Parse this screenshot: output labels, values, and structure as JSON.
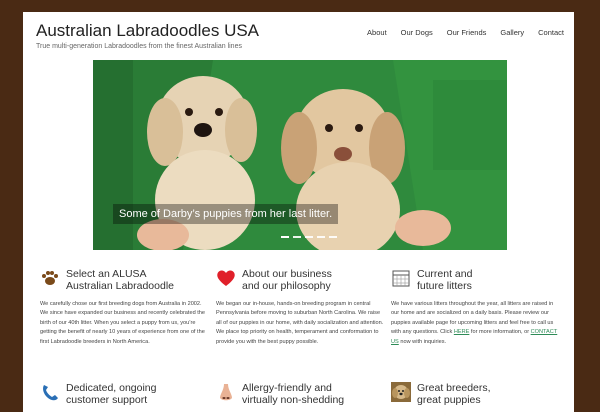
{
  "site": {
    "title": "Australian Labradoodles USA",
    "tagline": "True multi-generation Labradoodles from the finest Australian lines"
  },
  "nav": {
    "items": [
      {
        "label": "About"
      },
      {
        "label": "Our Dogs"
      },
      {
        "label": "Our Friends"
      },
      {
        "label": "Gallery"
      },
      {
        "label": "Contact"
      }
    ]
  },
  "slider": {
    "caption": "Some of Darby’s puppies from her last litter.",
    "slide_count": 5,
    "active_index": 0
  },
  "features": [
    {
      "icon": "paw-icon",
      "title": "Select an ALUSA\nAustralian Labradoodle",
      "body": "We carefully chose our first breeding dogs from Australia in 2002. We since have expanded our business and recently celebrated the birth of our 40th litter. When you select a puppy from us, you’re getting the benefit of nearly 10 years of experience from one of the first Labradoodle breeders in North America."
    },
    {
      "icon": "heart-icon",
      "title": "About our business\nand our philosophy",
      "body": "We began our in-house, hands-on breeding program in central Pennsylvania before moving to suburban North Carolina. We raise all of our puppies in our home, with daily socialization and attention. We place top priority on health, temperament and conformation to provide you with the best puppy possible."
    },
    {
      "icon": "calendar-icon",
      "title": "Current and\nfuture litters",
      "body_pre": "We have various litters throughout the year, all litters are raised in our home and are socialized on a daily basis. Please review our puppies available page for upcoming litters and feel free to call us with any questions. Click",
      "link_here": "HERE",
      "body_mid": "for more information, or",
      "link_contact": "CONTACT US",
      "body_post": "now with inquiries."
    },
    {
      "icon": "phone-icon",
      "title": "Dedicated, ongoing\ncustomer support"
    },
    {
      "icon": "nose-icon",
      "title": "Allergy-friendly and\nvirtually non-shedding"
    },
    {
      "icon": "dog-photo-icon",
      "title": "Great breeders,\ngreat puppies"
    }
  ],
  "colors": {
    "background": "#4a2a14",
    "link": "#2e8b57",
    "heart": "#e0202a",
    "paw": "#7a4a1a"
  }
}
